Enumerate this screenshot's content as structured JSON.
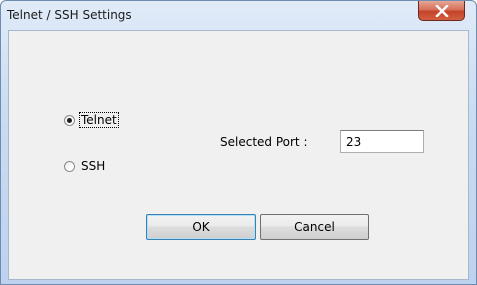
{
  "window": {
    "title": "Telnet / SSH Settings"
  },
  "titlebar_buttons": {
    "close_icon": "close-x-icon"
  },
  "protocol": {
    "options": [
      {
        "label": "Telnet",
        "checked": true,
        "focused": true
      },
      {
        "label": "SSH",
        "checked": false,
        "focused": false
      }
    ]
  },
  "port": {
    "label": "Selected Port :",
    "value": "23"
  },
  "actions": {
    "ok_label": "OK",
    "cancel_label": "Cancel"
  },
  "colors": {
    "close_button": "#c4432a",
    "default_button_border": "#3c7fb1",
    "client_background": "#f0f0f0"
  }
}
